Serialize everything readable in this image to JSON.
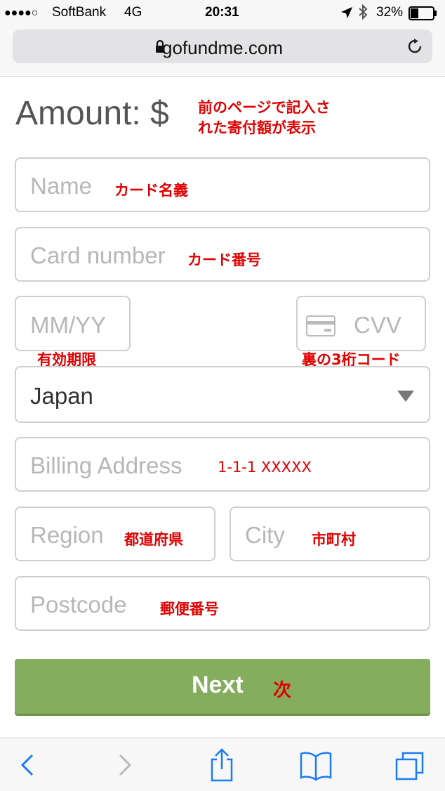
{
  "status_bar": {
    "signal": "●●●●○",
    "carrier": "SoftBank",
    "network": "4G",
    "time": "20:31",
    "battery": "32%"
  },
  "browser": {
    "url": "gofundme.com"
  },
  "form": {
    "amount_label": "Amount: $",
    "amount_note_line1": "前のページで記入さ",
    "amount_note_line2": "れた寄付額が表示",
    "name_placeholder": "Name",
    "name_note": "カード名義",
    "card_placeholder": "Card number",
    "card_note": "カード番号",
    "expiry_placeholder": "MM/YY",
    "expiry_note": "有効期限",
    "cvv_placeholder": "CVV",
    "cvv_note": "裏の3桁コード",
    "country_value": "Japan",
    "address_placeholder": "Billing Address",
    "address_note": "1-1-1 XXXXX",
    "region_placeholder": "Region",
    "region_note": "都道府県",
    "city_placeholder": "City",
    "city_note": "市町村",
    "postcode_placeholder": "Postcode",
    "postcode_note": "郵便番号",
    "next_label": "Next",
    "next_note": "次"
  },
  "colors": {
    "accent": "#85ad5e",
    "annotation": "#e00000",
    "ios_blue": "#1a7cf5"
  },
  "icons": [
    "location-arrow-icon",
    "bluetooth-icon",
    "battery-icon",
    "lock-icon",
    "reload-icon",
    "credit-card-icon",
    "dropdown-triangle-icon",
    "back-chevron-icon",
    "forward-chevron-icon",
    "share-icon",
    "bookmarks-icon",
    "tabs-icon"
  ]
}
